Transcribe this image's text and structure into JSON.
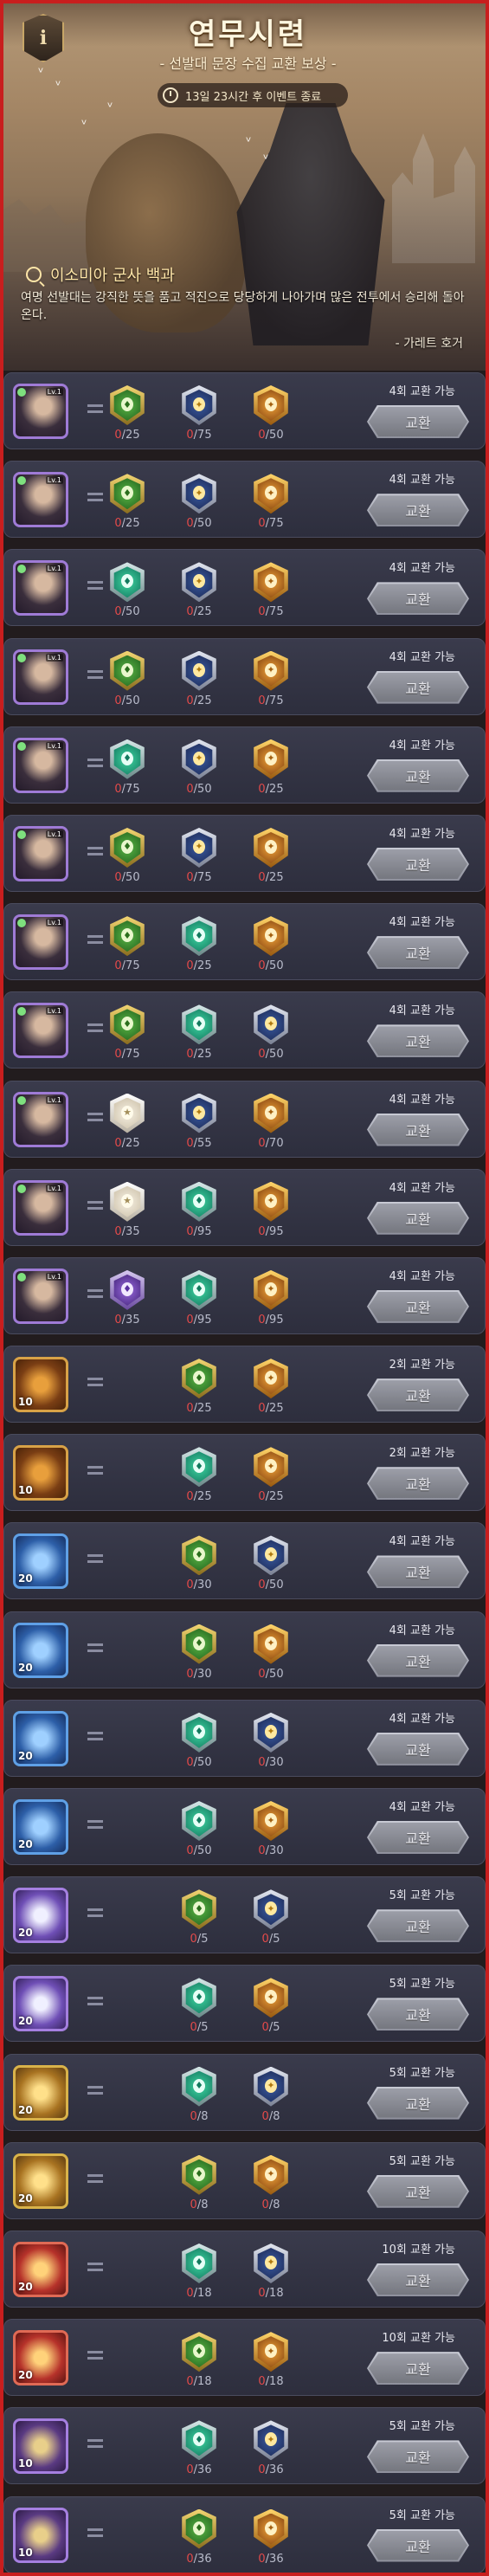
{
  "header": {
    "title": "연무시련",
    "subtitle": "- 선발대 문장 수집 교환 보상 -",
    "timer": "13일 23시간 후 이벤트 종료",
    "lore_title": "이소미아 군사 백과",
    "quote": "여명 선발대는 강직한 뜻을 품고 적진으로 당당하게 나아가며 많은 전투에서 승리해 돌아온다.",
    "author": "- 가레트 호거"
  },
  "exchange_label": "교환",
  "rows": [
    {
      "thumb": "hero",
      "lv": "Lv.1",
      "count": "",
      "avail": "4회 교환 가능",
      "costs": [
        {
          "badge": "green",
          "have": "0",
          "total": "25"
        },
        {
          "badge": "silver",
          "have": "0",
          "total": "75"
        },
        {
          "badge": "gold",
          "have": "0",
          "total": "50"
        }
      ]
    },
    {
      "thumb": "hero",
      "lv": "Lv.1",
      "count": "",
      "avail": "4회 교환 가능",
      "costs": [
        {
          "badge": "green",
          "have": "0",
          "total": "25"
        },
        {
          "badge": "silver",
          "have": "0",
          "total": "50"
        },
        {
          "badge": "gold",
          "have": "0",
          "total": "75"
        }
      ]
    },
    {
      "thumb": "hero",
      "lv": "Lv.1",
      "count": "",
      "avail": "4회 교환 가능",
      "costs": [
        {
          "badge": "teal",
          "have": "0",
          "total": "50"
        },
        {
          "badge": "silver",
          "have": "0",
          "total": "25"
        },
        {
          "badge": "gold",
          "have": "0",
          "total": "75"
        }
      ]
    },
    {
      "thumb": "hero",
      "lv": "Lv.1",
      "count": "",
      "avail": "4회 교환 가능",
      "costs": [
        {
          "badge": "green",
          "have": "0",
          "total": "50"
        },
        {
          "badge": "silver",
          "have": "0",
          "total": "25"
        },
        {
          "badge": "gold",
          "have": "0",
          "total": "75"
        }
      ]
    },
    {
      "thumb": "hero",
      "lv": "Lv.1",
      "count": "",
      "avail": "4회 교환 가능",
      "costs": [
        {
          "badge": "teal",
          "have": "0",
          "total": "75"
        },
        {
          "badge": "silver",
          "have": "0",
          "total": "50"
        },
        {
          "badge": "gold",
          "have": "0",
          "total": "25"
        }
      ]
    },
    {
      "thumb": "hero",
      "lv": "Lv.1",
      "count": "",
      "avail": "4회 교환 가능",
      "costs": [
        {
          "badge": "green",
          "have": "0",
          "total": "50"
        },
        {
          "badge": "silver",
          "have": "0",
          "total": "75"
        },
        {
          "badge": "gold",
          "have": "0",
          "total": "25"
        }
      ]
    },
    {
      "thumb": "hero",
      "lv": "Lv.1",
      "count": "",
      "avail": "4회 교환 가능",
      "costs": [
        {
          "badge": "green",
          "have": "0",
          "total": "75"
        },
        {
          "badge": "teal",
          "have": "0",
          "total": "25"
        },
        {
          "badge": "gold",
          "have": "0",
          "total": "50"
        }
      ]
    },
    {
      "thumb": "hero",
      "lv": "Lv.1",
      "count": "",
      "avail": "4회 교환 가능",
      "costs": [
        {
          "badge": "green",
          "have": "0",
          "total": "75"
        },
        {
          "badge": "teal",
          "have": "0",
          "total": "25"
        },
        {
          "badge": "silver",
          "have": "0",
          "total": "50"
        }
      ]
    },
    {
      "thumb": "hero",
      "lv": "Lv.1",
      "count": "",
      "avail": "4회 교환 가능",
      "costs": [
        {
          "badge": "white",
          "have": "0",
          "total": "25"
        },
        {
          "badge": "silver",
          "have": "0",
          "total": "55"
        },
        {
          "badge": "gold",
          "have": "0",
          "total": "70"
        }
      ]
    },
    {
      "thumb": "hero",
      "lv": "Lv.1",
      "count": "",
      "avail": "4회 교환 가능",
      "costs": [
        {
          "badge": "white",
          "have": "0",
          "total": "35"
        },
        {
          "badge": "teal",
          "have": "0",
          "total": "95"
        },
        {
          "badge": "gold",
          "have": "0",
          "total": "95"
        }
      ]
    },
    {
      "thumb": "hero",
      "lv": "Lv.1",
      "count": "",
      "avail": "4회 교환 가능",
      "costs": [
        {
          "badge": "purple",
          "have": "0",
          "total": "35"
        },
        {
          "badge": "teal",
          "have": "0",
          "total": "95"
        },
        {
          "badge": "gold",
          "have": "0",
          "total": "95"
        }
      ]
    },
    {
      "thumb": "item-orange",
      "lv": "",
      "count": "10",
      "avail": "2회 교환 가능",
      "costs": [
        {
          "badge": "green",
          "have": "0",
          "total": "25"
        },
        {
          "badge": "gold",
          "have": "0",
          "total": "25"
        }
      ]
    },
    {
      "thumb": "item-orange",
      "lv": "",
      "count": "10",
      "avail": "2회 교환 가능",
      "costs": [
        {
          "badge": "teal",
          "have": "0",
          "total": "25"
        },
        {
          "badge": "gold",
          "have": "0",
          "total": "25"
        }
      ]
    },
    {
      "thumb": "item-blue",
      "lv": "",
      "count": "20",
      "avail": "4회 교환 가능",
      "costs": [
        {
          "badge": "green",
          "have": "0",
          "total": "30"
        },
        {
          "badge": "silver",
          "have": "0",
          "total": "50"
        }
      ]
    },
    {
      "thumb": "item-blue",
      "lv": "",
      "count": "20",
      "avail": "4회 교환 가능",
      "costs": [
        {
          "badge": "green",
          "have": "0",
          "total": "30"
        },
        {
          "badge": "gold",
          "have": "0",
          "total": "50"
        }
      ]
    },
    {
      "thumb": "item-blue",
      "lv": "",
      "count": "20",
      "avail": "4회 교환 가능",
      "costs": [
        {
          "badge": "teal",
          "have": "0",
          "total": "50"
        },
        {
          "badge": "silver",
          "have": "0",
          "total": "30"
        }
      ]
    },
    {
      "thumb": "item-blue",
      "lv": "",
      "count": "20",
      "avail": "4회 교환 가능",
      "costs": [
        {
          "badge": "teal",
          "have": "0",
          "total": "50"
        },
        {
          "badge": "gold",
          "have": "0",
          "total": "30"
        }
      ]
    },
    {
      "thumb": "item-purple",
      "lv": "",
      "count": "20",
      "avail": "5회 교환 가능",
      "costs": [
        {
          "badge": "green",
          "have": "0",
          "total": "5"
        },
        {
          "badge": "silver",
          "have": "0",
          "total": "5"
        }
      ]
    },
    {
      "thumb": "item-purple",
      "lv": "",
      "count": "20",
      "avail": "5회 교환 가능",
      "costs": [
        {
          "badge": "teal",
          "have": "0",
          "total": "5"
        },
        {
          "badge": "gold",
          "have": "0",
          "total": "5"
        }
      ]
    },
    {
      "thumb": "item-gold",
      "lv": "",
      "count": "20",
      "avail": "5회 교환 가능",
      "costs": [
        {
          "badge": "teal",
          "have": "0",
          "total": "8"
        },
        {
          "badge": "silver",
          "have": "0",
          "total": "8"
        }
      ]
    },
    {
      "thumb": "item-gold",
      "lv": "",
      "count": "20",
      "avail": "5회 교환 가능",
      "costs": [
        {
          "badge": "green",
          "have": "0",
          "total": "8"
        },
        {
          "badge": "gold",
          "have": "0",
          "total": "8"
        }
      ]
    },
    {
      "thumb": "item-red",
      "lv": "",
      "count": "20",
      "avail": "10회 교환 가능",
      "costs": [
        {
          "badge": "teal",
          "have": "0",
          "total": "18"
        },
        {
          "badge": "silver",
          "have": "0",
          "total": "18"
        }
      ]
    },
    {
      "thumb": "item-red",
      "lv": "",
      "count": "20",
      "avail": "10회 교환 가능",
      "costs": [
        {
          "badge": "green",
          "have": "0",
          "total": "18"
        },
        {
          "badge": "gold",
          "have": "0",
          "total": "18"
        }
      ]
    },
    {
      "thumb": "item-scroll",
      "lv": "",
      "count": "10",
      "avail": "5회 교환 가능",
      "costs": [
        {
          "badge": "teal",
          "have": "0",
          "total": "36"
        },
        {
          "badge": "silver",
          "have": "0",
          "total": "36"
        }
      ]
    },
    {
      "thumb": "item-scroll",
      "lv": "",
      "count": "10",
      "avail": "5회 교환 가능",
      "costs": [
        {
          "badge": "green",
          "have": "0",
          "total": "36"
        },
        {
          "badge": "gold",
          "have": "0",
          "total": "36"
        }
      ]
    }
  ]
}
